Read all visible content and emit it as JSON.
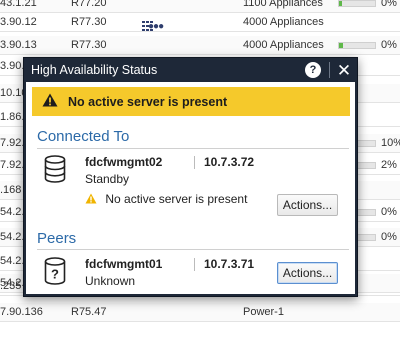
{
  "background_rows": [
    {
      "ip": "43.1.21",
      "version": "R77.20",
      "icons": false,
      "devices": "1100 Appliances",
      "bar_fraction": 0.08,
      "percent": "0%"
    },
    {
      "ip": "3.90.12",
      "version": "R77.30",
      "icons": true,
      "devices": "4000 Appliances",
      "bar_fraction": null,
      "percent": ""
    },
    {
      "ip": "3.90.13",
      "version": "R77.30",
      "icons": false,
      "devices": "4000 Appliances",
      "bar_fraction": 0.1,
      "percent": "0%"
    },
    {
      "ip": "3.90.7",
      "version": "",
      "icons": false,
      "devices": "",
      "bar_fraction": null,
      "percent": ""
    },
    {
      "ip": "10.10",
      "version": "",
      "icons": false,
      "devices": "",
      "bar_fraction": null,
      "percent": ""
    },
    {
      "ip": "1.86.6",
      "version": "",
      "icons": false,
      "devices": "",
      "bar_fraction": null,
      "percent": ""
    },
    {
      "ip": "7.92.",
      "version": "",
      "icons": false,
      "devices": "",
      "bar_fraction": 0.1,
      "percent": "10%"
    },
    {
      "ip": "7.92.",
      "version": "",
      "icons": false,
      "devices": "",
      "bar_fraction": 0.02,
      "percent": "2%"
    },
    {
      "ip": ".168",
      "version": "",
      "icons": false,
      "devices": "",
      "bar_fraction": null,
      "percent": ""
    },
    {
      "ip": "54.2.",
      "version": "",
      "icons": false,
      "devices": "",
      "bar_fraction": 0.0,
      "percent": "0%"
    },
    {
      "ip": "54.2.",
      "version": "",
      "icons": false,
      "devices": "",
      "bar_fraction": 0.0,
      "percent": "0%"
    },
    {
      "ip": "54.2.",
      "version": "",
      "icons": false,
      "devices": "",
      "bar_fraction": null,
      "percent": ""
    },
    {
      "ip": "54.2.",
      "version": "",
      "icons": false,
      "devices": "",
      "bar_fraction": null,
      "percent": ""
    },
    {
      "ip": ".235",
      "version": "",
      "icons": false,
      "devices": "",
      "bar_fraction": null,
      "percent": ""
    },
    {
      "ip": "7.90.136",
      "version": "R75.47",
      "icons": false,
      "devices": "Power-1",
      "bar_fraction": null,
      "percent": ""
    }
  ],
  "dialog": {
    "title": "High Availability Status",
    "help_label": "?",
    "close_label": "✕",
    "alert_text": "No active server is present",
    "connected": {
      "section_title": "Connected To",
      "name": "fdcfwmgmt02",
      "ip": "10.7.3.72",
      "state": "Standby",
      "warning": "No active server is present",
      "actions_label": "Actions..."
    },
    "peers": {
      "section_title": "Peers",
      "name": "fdcfwmgmt01",
      "ip": "10.7.3.71",
      "state": "Unknown",
      "actions_label": "Actions..."
    }
  },
  "colors": {
    "dialog_header": "#1e2838",
    "alert_background": "#f5c92b",
    "section_title": "#2c6aa8",
    "progress_fill": "#5fb84a"
  },
  "icons": {
    "alert": "warning-icon",
    "connected_server": "database-icon",
    "peer_server": "database-unknown-icon"
  }
}
